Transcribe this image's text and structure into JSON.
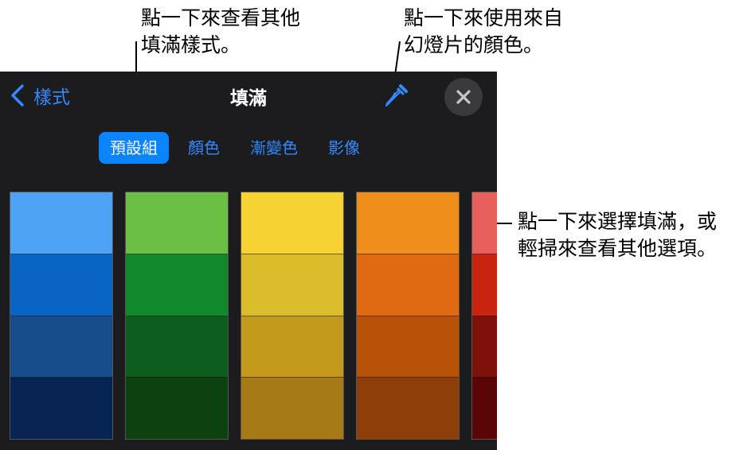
{
  "callouts": {
    "styles": [
      "點一下來查看其他",
      "填滿樣式。"
    ],
    "slide_color": [
      "點一下來使用來自",
      "幻燈片的顏色。"
    ],
    "fill": [
      "點一下來選擇填滿，或",
      "輕掃來查看其他選項。"
    ]
  },
  "nav": {
    "back_label": "樣式",
    "title": "填滿"
  },
  "icons": {
    "back": "chevron-left-icon",
    "eyedropper": "eyedropper-icon",
    "close": "close-icon"
  },
  "tabs": [
    {
      "label": "預設組",
      "active": true
    },
    {
      "label": "顏色",
      "active": false
    },
    {
      "label": "漸變色",
      "active": false
    },
    {
      "label": "影像",
      "active": false
    }
  ],
  "colors": {
    "accent": "#0a84ff",
    "link": "#2f8bff",
    "panel_bg": "#1c1c1e",
    "close_bg": "#3a3a3c"
  },
  "swatch_columns": [
    {
      "name": "blue",
      "colors": [
        "#4fa3f5",
        "#0a64c4",
        "#164d8a",
        "#072452"
      ]
    },
    {
      "name": "green",
      "colors": [
        "#6cbf45",
        "#10892c",
        "#0d5e1e",
        "#0b4210"
      ]
    },
    {
      "name": "yellow",
      "colors": [
        "#f6d232",
        "#dbbd2b",
        "#c49a1c",
        "#a67a16"
      ]
    },
    {
      "name": "orange",
      "colors": [
        "#f08e1c",
        "#e06a12",
        "#b85208",
        "#8e3e08"
      ]
    },
    {
      "name": "red",
      "colors": [
        "#e8605c",
        "#c82410",
        "#7e120a",
        "#5a0606"
      ]
    }
  ]
}
